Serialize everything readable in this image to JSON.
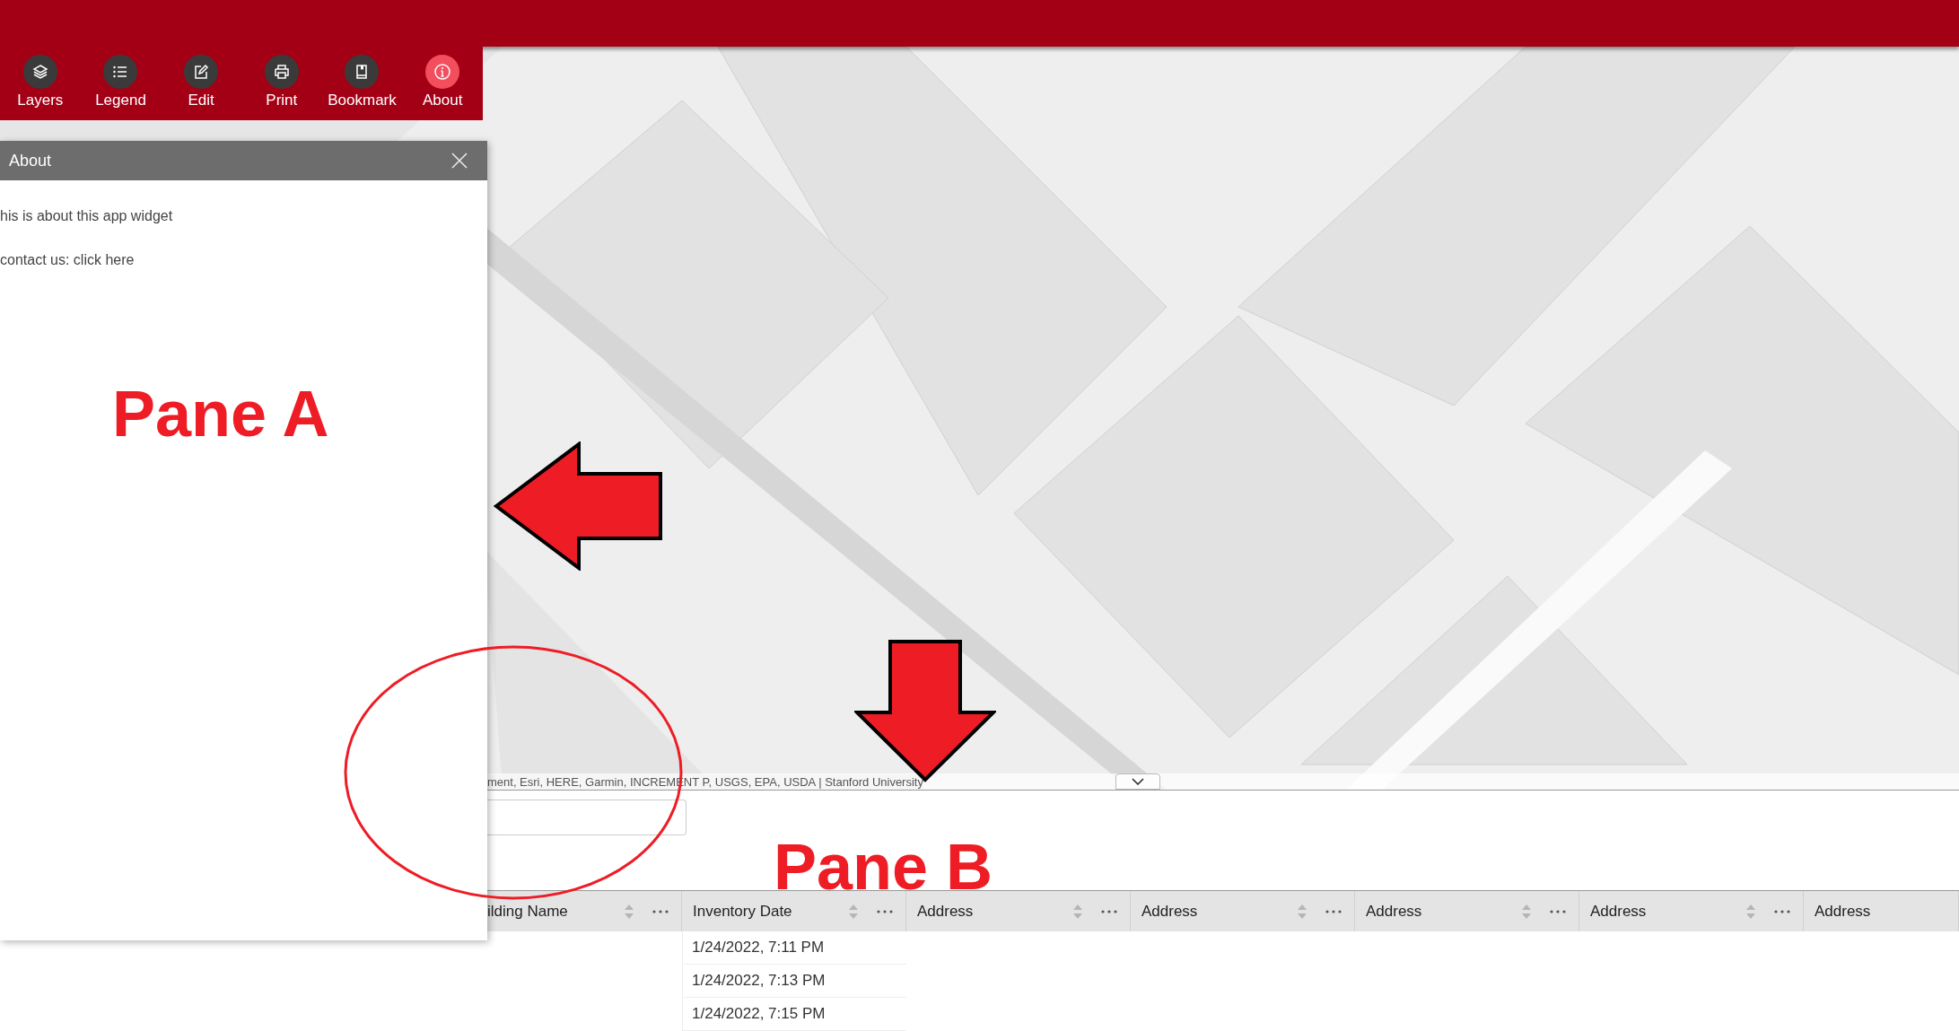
{
  "toolbar": [
    {
      "label": "Layers",
      "selected": false
    },
    {
      "label": "Legend",
      "selected": false
    },
    {
      "label": "Edit",
      "selected": false
    },
    {
      "label": "Print",
      "selected": false
    },
    {
      "label": "Bookmark",
      "selected": false
    },
    {
      "label": "About",
      "selected": true
    }
  ],
  "panel": {
    "title": "About",
    "lines": [
      "his is about this app widget",
      "contact us: click here"
    ]
  },
  "map": {
    "kind": "picture",
    "attribution": "ment, Esri, HERE, Garmin, INCREMENT P, USGS, EPA, USDA | Stanford University"
  },
  "table": {
    "columns": [
      {
        "label": "ilding Name",
        "kind": "sortable"
      },
      {
        "label": "Inventory Date",
        "kind": "sortable"
      },
      {
        "label": "Address",
        "kind": "sortable"
      },
      {
        "label": "Address",
        "kind": "sortable"
      },
      {
        "label": "Address",
        "kind": "sortable"
      },
      {
        "label": "Address",
        "kind": "sortable"
      },
      {
        "label": "Address",
        "kind": "plain"
      }
    ],
    "rows": [
      {
        "inventory_date": "1/24/2022, 7:11 PM"
      },
      {
        "inventory_date": "1/24/2022, 7:13 PM"
      },
      {
        "inventory_date": "1/24/2022, 7:15 PM"
      }
    ]
  },
  "annotations": [
    {
      "kind": "text",
      "text": "Pane A"
    },
    {
      "kind": "arrow-left"
    },
    {
      "kind": "ellipse"
    },
    {
      "kind": "arrow-down"
    },
    {
      "kind": "text",
      "text": "Pane B"
    }
  ]
}
